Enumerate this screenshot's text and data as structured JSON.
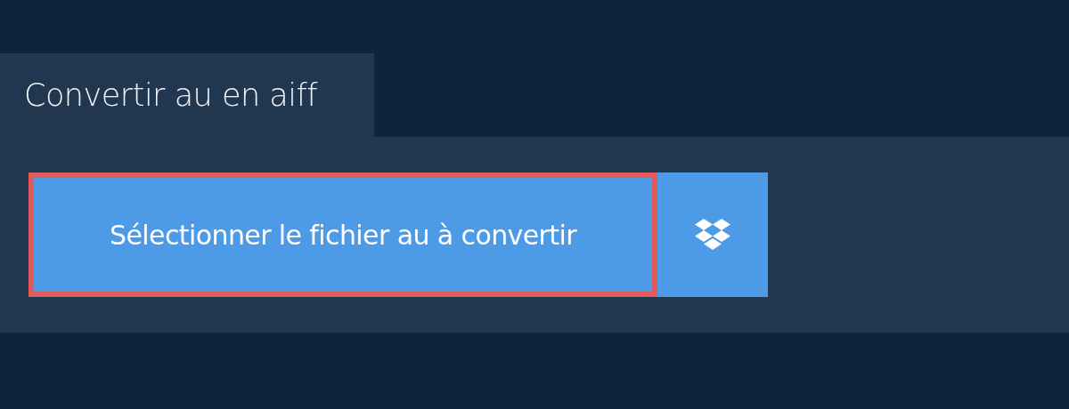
{
  "tab": {
    "label": "Convertir au en aiff"
  },
  "select_button": {
    "label": "Sélectionner le fichier au à convertir",
    "focused": true
  }
}
